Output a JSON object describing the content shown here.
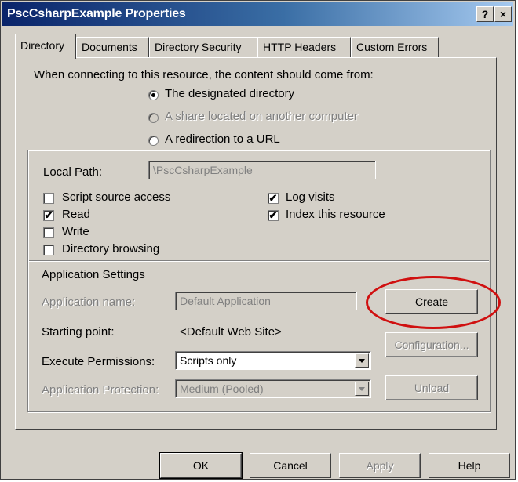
{
  "window": {
    "title": "PscCsharpExample Properties"
  },
  "titlebar": {
    "help_label": "?",
    "close_label": "×"
  },
  "tabs": [
    {
      "label": "Directory",
      "active": true
    },
    {
      "label": "Documents"
    },
    {
      "label": "Directory Security"
    },
    {
      "label": "HTTP Headers"
    },
    {
      "label": "Custom Errors"
    }
  ],
  "content": {
    "prompt": "When connecting to this resource, the content should come from:",
    "options": [
      {
        "label": "The designated directory",
        "selected": true,
        "enabled": true
      },
      {
        "label": "A share located on another computer",
        "selected": false,
        "enabled": false
      },
      {
        "label": "A redirection to a URL",
        "selected": false,
        "enabled": true
      }
    ]
  },
  "local_path": {
    "label": "Local Path:",
    "value": "\\PscCsharpExample"
  },
  "checkboxes": {
    "script_source_access": {
      "label": "Script source access",
      "checked": false
    },
    "read": {
      "label": "Read",
      "checked": true
    },
    "write": {
      "label": "Write",
      "checked": false
    },
    "directory_browsing": {
      "label": "Directory browsing",
      "checked": false
    },
    "log_visits": {
      "label": "Log visits",
      "checked": true
    },
    "index_resource": {
      "label": "Index this resource",
      "checked": true
    }
  },
  "check_mark": "✔",
  "app_settings": {
    "heading": "Application Settings",
    "name_label": "Application name:",
    "name_value": "Default Application",
    "starting_point_label": "Starting point:",
    "starting_point_value": "<Default Web Site>",
    "exec_label": "Execute Permissions:",
    "exec_value": "Scripts only",
    "protection_label": "Application Protection:",
    "protection_value": "Medium (Pooled)",
    "create_label": "Create",
    "configuration_label": "Configuration...",
    "unload_label": "Unload"
  },
  "footer": {
    "ok": "OK",
    "cancel": "Cancel",
    "apply": "Apply",
    "help": "Help"
  },
  "colors": {
    "highlight": "#d01010",
    "titlebar_start": "#0a246a",
    "face": "#d4d0c8"
  }
}
